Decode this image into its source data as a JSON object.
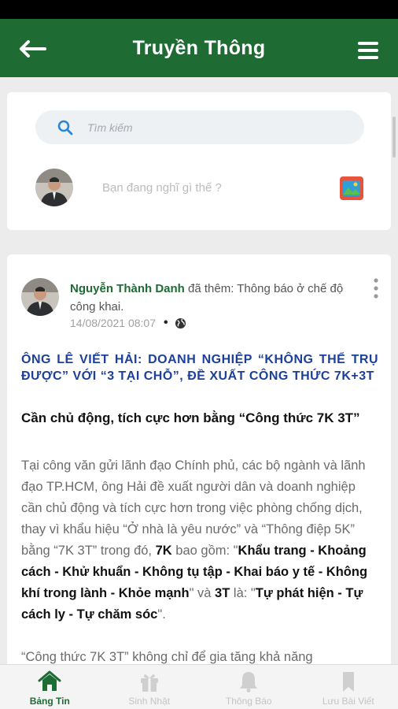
{
  "app": {
    "title": "Truyền Thông"
  },
  "icons": {
    "back": "arrow-left-icon",
    "menu": "hamburger-menu-icon",
    "search": "search-icon",
    "photo": "image-icon",
    "more": "more-vertical-icon",
    "globe": "globe-icon"
  },
  "colors": {
    "primary": "#1e6b34",
    "headline": "#1c3f9b",
    "search_bg": "#eef1f4"
  },
  "composer": {
    "search_placeholder": "Tìm kiếm",
    "prompt": "Bạn đang nghĩ gì thế ?"
  },
  "post": {
    "author": "Nguyễn Thành Danh",
    "action": " đã thêm: Thông báo ở chế độ công khai.",
    "timestamp": "14/08/2021 08:07",
    "headline": "ÔNG LÊ VIẾT HẢI: DOANH NGHIỆP “KHÔNG THỂ TRỤ ĐƯỢC” VỚI “3 TẠI CHỖ”, ĐỀ XUẤT CÔNG THỨC 7K+3T",
    "subhead": "Cần chủ động, tích cực hơn bằng “Công thức 7K 3T”",
    "body": {
      "p1": "Tại công văn gửi lãnh đạo Chính phủ, các bộ ngành và lãnh đạo TP.HCM, ông Hải đề xuất người dân và doanh nghiệp cần chủ động và tích cực hơn trong việc phòng chống dịch, thay vì khẩu hiệu “Ở nhà là yêu nước” và “Thông điệp 5K” bằng “7K 3T” trong đó, ",
      "k7": "7K",
      "p2": " bao gồm: \"",
      "k7_list": "Khẩu trang - Khoảng cách - Khử khuẩn - Không tụ tập - Khai báo y tế - Không khí trong lành - Khỏe mạnh",
      "p3": "\" và ",
      "t3": "3T",
      "p4": " là: \"",
      "t3_list": "Tự phát hiện - Tự cách ly - Tự chăm sóc",
      "p5": "\".",
      "next_paragraph": "“Công thức 7K 3T” không chỉ để gia tăng khả năng"
    }
  },
  "nav": [
    {
      "label": "Bảng Tin",
      "icon": "home-icon",
      "active": true
    },
    {
      "label": "Sinh Nhật",
      "icon": "gift-icon",
      "active": false
    },
    {
      "label": "Thông Báo",
      "icon": "bell-icon",
      "active": false
    },
    {
      "label": "Lưu Bài Viết",
      "icon": "bookmark-icon",
      "active": false
    }
  ]
}
